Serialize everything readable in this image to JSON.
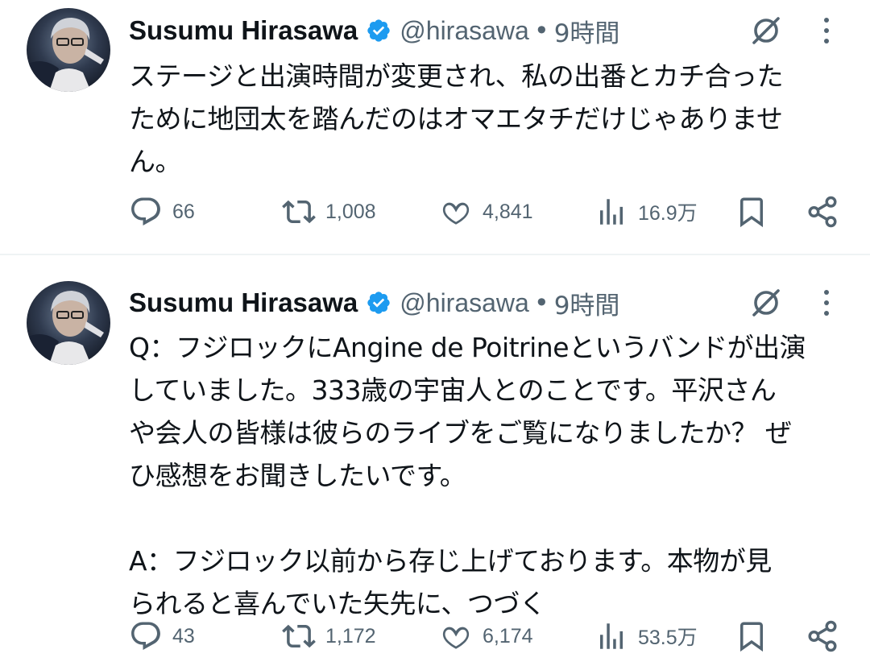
{
  "colors": {
    "text": "#0f1419",
    "muted": "#536471",
    "verified": "#1d9bf0",
    "divider": "#eff3f4"
  },
  "tweets": [
    {
      "author": {
        "name": "Susumu Hirasawa",
        "handle": "@hirasawa",
        "verified": true,
        "avatar": "avatar-photo"
      },
      "separator": "•",
      "time": "9時間",
      "text": "ステージと出演時間が変更され、私の出番とカチ合った\nために地団太を踏んだのはオマエタチだけじゃありませ\nん。",
      "actions": {
        "replies": "66",
        "reposts": "1,008",
        "likes": "4,841",
        "views": "16.9万"
      },
      "icons": [
        "grok-icon",
        "more-icon",
        "reply-icon",
        "repost-icon",
        "like-icon",
        "views-icon",
        "bookmark-icon",
        "share-icon"
      ]
    },
    {
      "author": {
        "name": "Susumu Hirasawa",
        "handle": "@hirasawa",
        "verified": true,
        "avatar": "avatar-photo"
      },
      "separator": "•",
      "time": "9時間",
      "text": "Q：フジロックにAngine de Poitrineというバンドが出演\nしていました。333歳の宇宙人とのことです。平沢さん\nや会人の皆様は彼らのライブをご覧になりましたか？ ぜ\nひ感想をお聞きしたいです。\n\nA：フジロック以前から存じ上げております。本物が見\nられると喜んでいた矢先に、つづく",
      "actions": {
        "replies": "43",
        "reposts": "1,172",
        "likes": "6,174",
        "views": "53.5万"
      },
      "icons": [
        "grok-icon",
        "more-icon",
        "reply-icon",
        "repost-icon",
        "like-icon",
        "views-icon",
        "bookmark-icon",
        "share-icon"
      ]
    }
  ]
}
